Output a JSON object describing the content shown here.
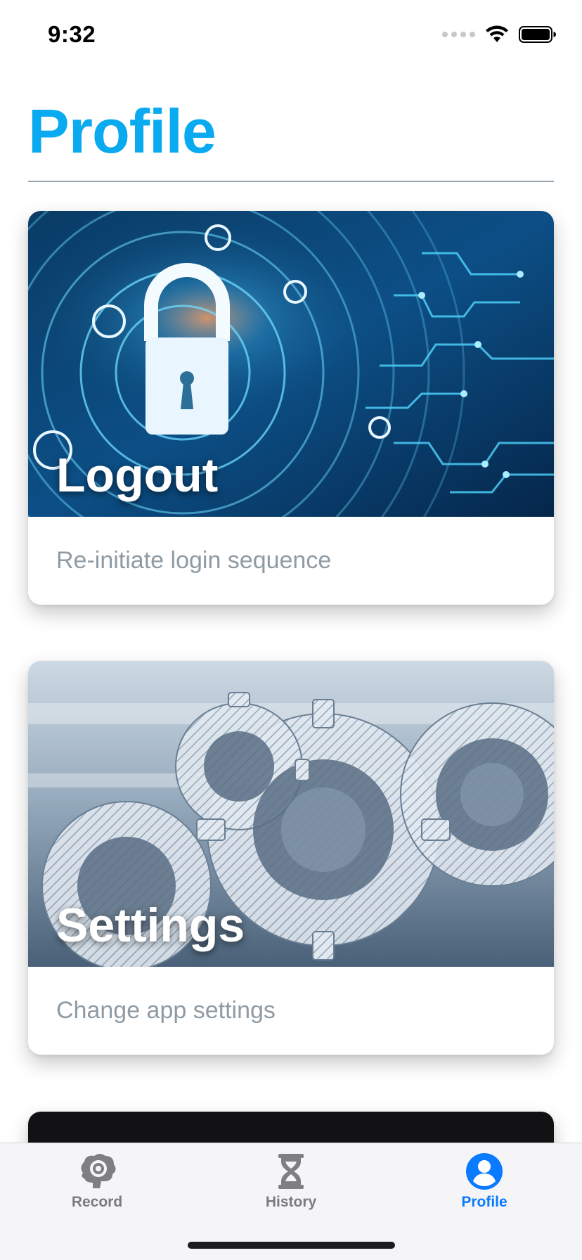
{
  "status_bar": {
    "time": "9:32"
  },
  "page": {
    "title": "Profile"
  },
  "cards": [
    {
      "title": "Logout",
      "description": "Re-initiate login sequence",
      "image_icon": "lock-icon"
    },
    {
      "title": "Settings",
      "description": "Change app settings",
      "image_icon": "gears-icon"
    }
  ],
  "tab_bar": {
    "items": [
      {
        "label": "Record",
        "icon": "brain-gear-icon",
        "active": false
      },
      {
        "label": "History",
        "icon": "hourglass-icon",
        "active": false
      },
      {
        "label": "Profile",
        "icon": "person-circle-icon",
        "active": true
      }
    ]
  },
  "colors": {
    "accent": "#0aaaf0",
    "tab_active": "#0a7aff",
    "tab_inactive": "#7a7a80"
  }
}
